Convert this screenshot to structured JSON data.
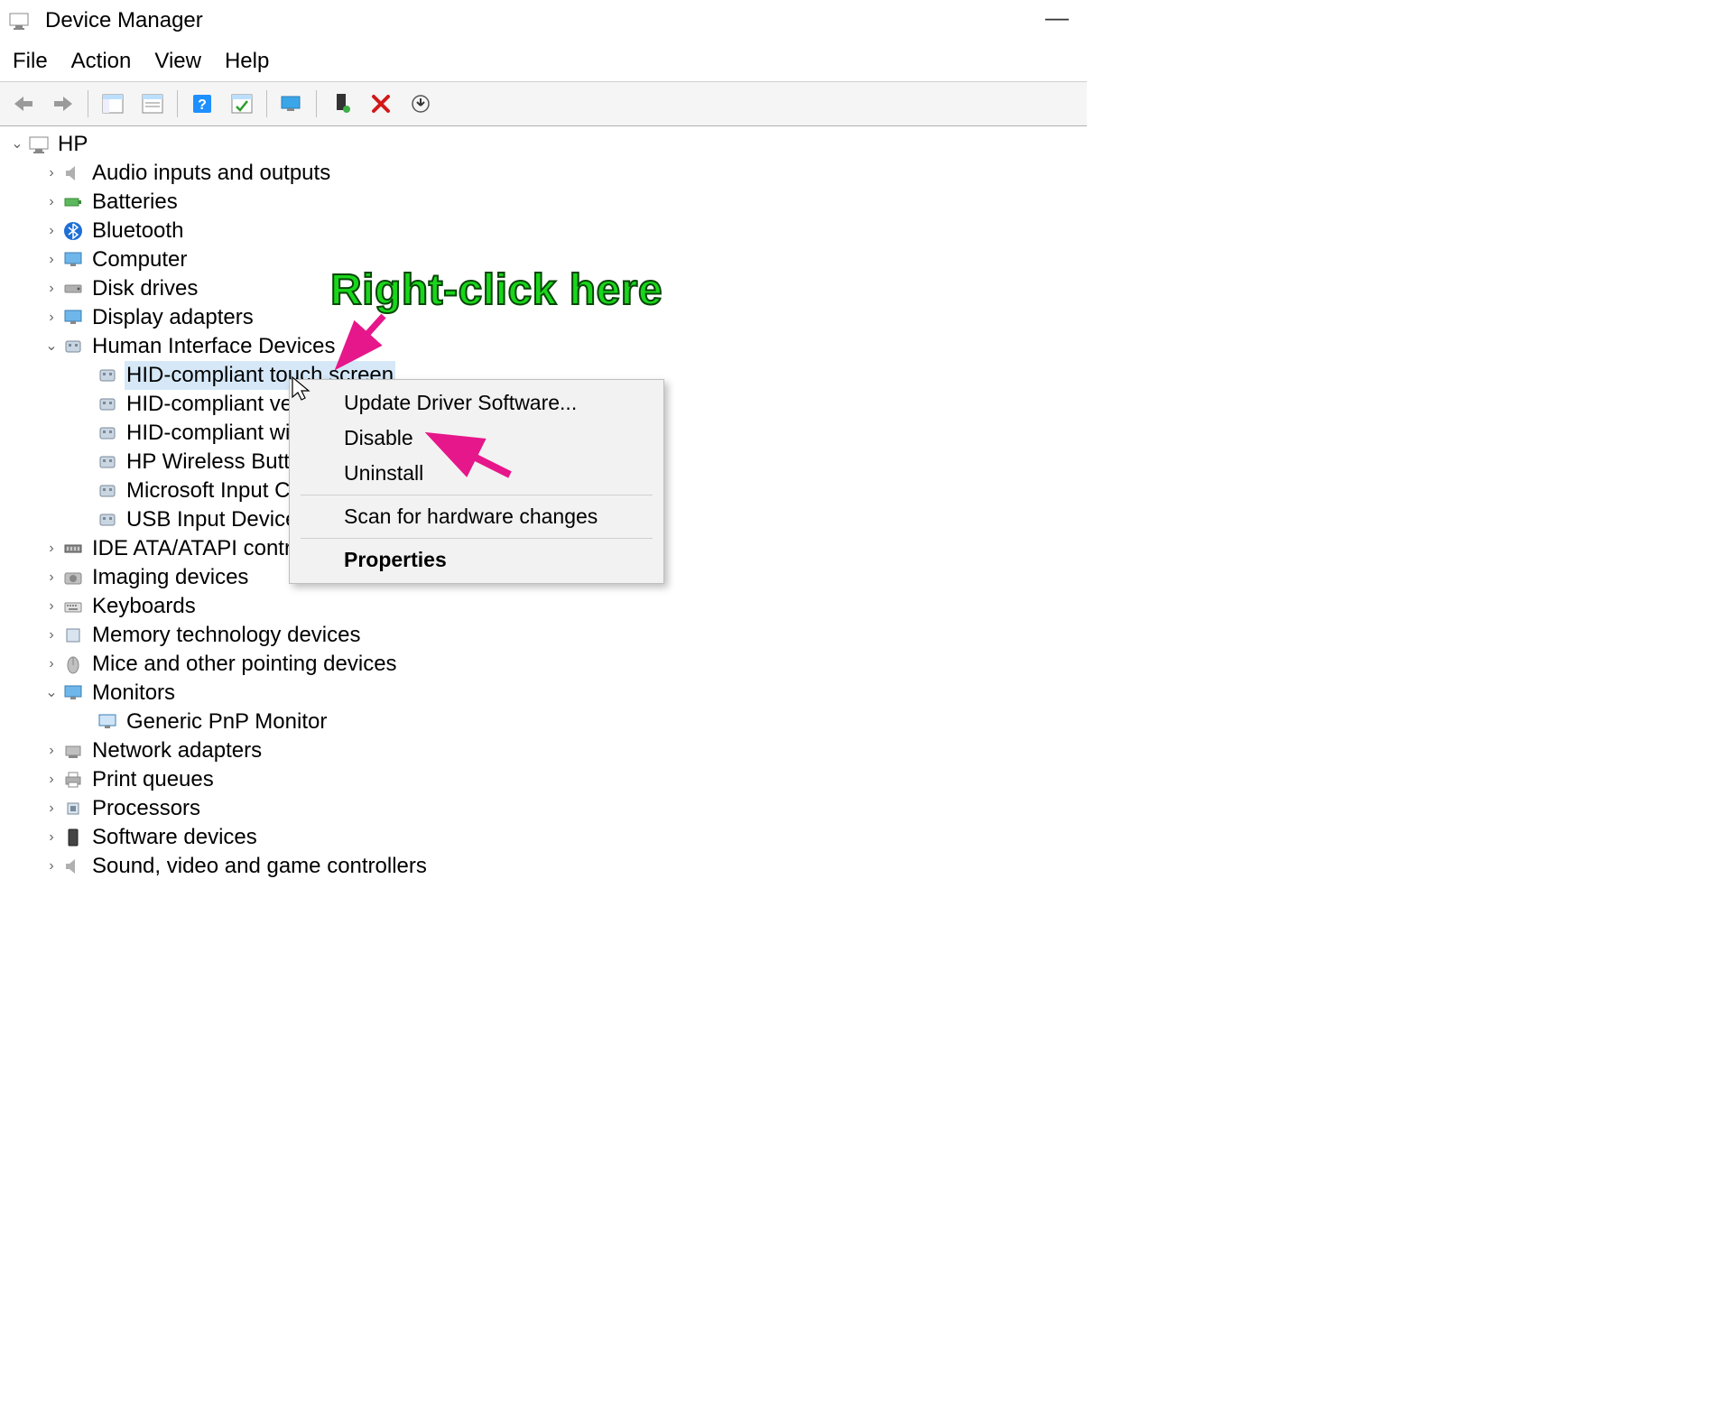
{
  "window": {
    "title": "Device Manager"
  },
  "menu": {
    "file": "File",
    "action": "Action",
    "view": "View",
    "help": "Help"
  },
  "toolbar_icons": {
    "back": "back-arrow",
    "forward": "forward-arrow",
    "properties1": "properties-pane",
    "properties2": "properties-pane-2",
    "help": "help",
    "enable": "enable",
    "monitor": "monitor",
    "scan": "scan-hardware",
    "delete": "delete",
    "update": "update-driver"
  },
  "tree": {
    "root": {
      "label": "HP"
    },
    "items": [
      {
        "label": "Audio inputs and outputs"
      },
      {
        "label": "Batteries"
      },
      {
        "label": "Bluetooth"
      },
      {
        "label": "Computer"
      },
      {
        "label": "Disk drives"
      },
      {
        "label": "Display adapters"
      },
      {
        "label": "Human Interface Devices"
      },
      {
        "label": "IDE ATA/ATAPI control"
      },
      {
        "label": "Imaging devices"
      },
      {
        "label": "Keyboards"
      },
      {
        "label": "Memory technology devices"
      },
      {
        "label": "Mice and other pointing devices"
      },
      {
        "label": "Monitors"
      },
      {
        "label": "Network adapters"
      },
      {
        "label": "Print queues"
      },
      {
        "label": "Processors"
      },
      {
        "label": "Software devices"
      },
      {
        "label": "Sound, video and game controllers"
      }
    ],
    "hid_children": [
      {
        "label": "HID-compliant touch screen"
      },
      {
        "label": "HID-compliant ver"
      },
      {
        "label": "HID-compliant wir"
      },
      {
        "label": "HP Wireless Buttor"
      },
      {
        "label": "Microsoft Input Co"
      },
      {
        "label": "USB Input Device"
      }
    ],
    "monitor_children": [
      {
        "label": "Generic PnP Monitor"
      }
    ]
  },
  "context_menu": {
    "update": "Update Driver Software...",
    "disable": "Disable",
    "uninstall": "Uninstall",
    "scan": "Scan for hardware changes",
    "properties": "Properties"
  },
  "annotation": {
    "text": "Right-click here"
  }
}
